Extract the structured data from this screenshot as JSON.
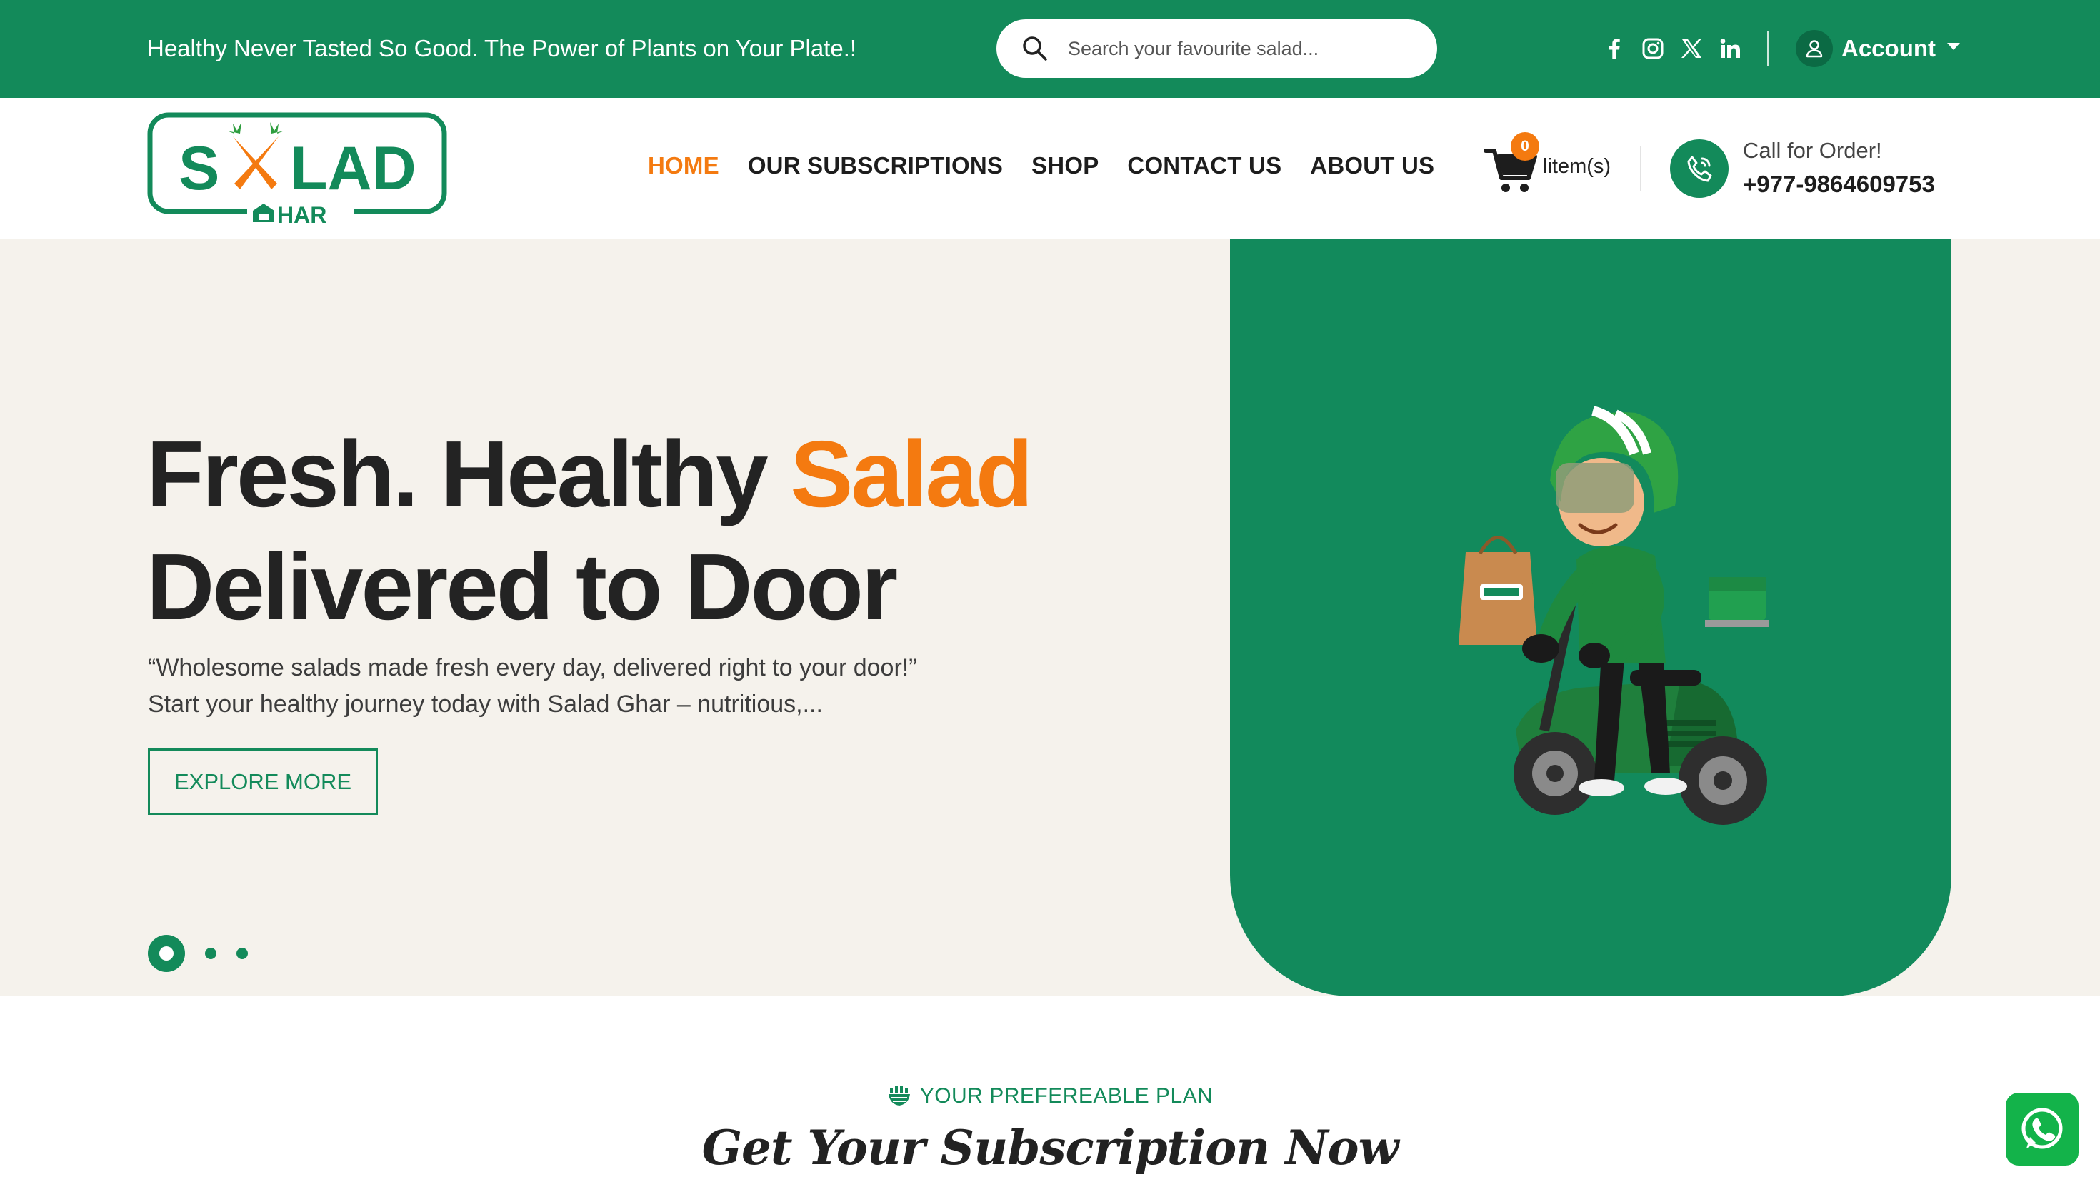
{
  "topbar": {
    "tagline": "Healthy Never Tasted So Good. The Power of Plants on Your Plate.!",
    "search_placeholder": "Search your favourite salad...",
    "socials": [
      "facebook-icon",
      "instagram-icon",
      "x-icon",
      "linkedin-icon"
    ],
    "account_label": "Account"
  },
  "header": {
    "nav": [
      {
        "label": "HOME",
        "active": true
      },
      {
        "label": "OUR SUBSCRIPTIONS",
        "active": false
      },
      {
        "label": "SHOP",
        "active": false
      },
      {
        "label": "CONTACT US",
        "active": false
      },
      {
        "label": "ABOUT US",
        "active": false
      }
    ],
    "cart_count": "0",
    "cart_text": "litem(s)",
    "call_label": "Call for Order!",
    "call_number": "+977-9864609753"
  },
  "hero": {
    "title_part1": "Fresh. Healthy ",
    "title_accent": "Salad",
    "title_part2": "Delivered to Door",
    "description": "“Wholesome salads made fresh every day, delivered right to your door!” Start your healthy journey today with Salad Ghar – nutritious,...",
    "cta_label": "EXPLORE MORE",
    "slides_total": 3,
    "active_slide": 1
  },
  "plans": {
    "eyebrow": "YOUR PREFEREABLE PLAN",
    "title": "Get Your Subscription Now"
  },
  "colors": {
    "brand_green": "#138a5a",
    "accent_orange": "#f47a10",
    "hero_bg": "#f5f2ec",
    "whatsapp_green": "#13b34a"
  }
}
